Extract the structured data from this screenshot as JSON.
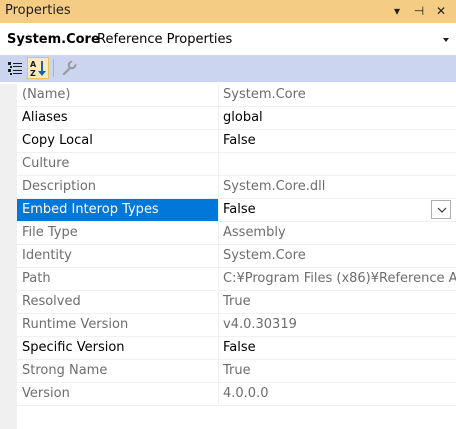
{
  "window": {
    "title": "Properties",
    "pin_glyph": "▾",
    "autohide_glyph": "⊣",
    "close_glyph": "✕"
  },
  "header": {
    "object_name": "System.Core",
    "object_type": "Reference Properties"
  },
  "toolbar": {
    "buttons": [
      {
        "icon": "categorized-icon",
        "active": false
      },
      {
        "icon": "alphabetical-sort-icon",
        "active": true
      },
      {
        "icon": "property-pages-wrench-icon",
        "active": false
      }
    ]
  },
  "properties": [
    {
      "name": "(Name)",
      "value": "System.Core",
      "readonly": true
    },
    {
      "name": "Aliases",
      "value": "global",
      "readonly": false
    },
    {
      "name": "Copy Local",
      "value": "False",
      "readonly": false
    },
    {
      "name": "Culture",
      "value": "",
      "readonly": true
    },
    {
      "name": "Description",
      "value": "System.Core.dll",
      "readonly": true
    },
    {
      "name": "Embed Interop Types",
      "value": "False",
      "readonly": false,
      "selected": true
    },
    {
      "name": "File Type",
      "value": "Assembly",
      "readonly": true
    },
    {
      "name": "Identity",
      "value": "System.Core",
      "readonly": true
    },
    {
      "name": "Path",
      "value": "C:¥Program Files (x86)¥Reference A",
      "readonly": true
    },
    {
      "name": "Resolved",
      "value": "True",
      "readonly": true
    },
    {
      "name": "Runtime Version",
      "value": "v4.0.30319",
      "readonly": true
    },
    {
      "name": "Specific Version",
      "value": "False",
      "readonly": false
    },
    {
      "name": "Strong Name",
      "value": "True",
      "readonly": true
    },
    {
      "name": "Version",
      "value": "4.0.0.0",
      "readonly": true
    }
  ],
  "colors": {
    "title_bar": "#f5cc84",
    "toolbar": "#ccd5f0",
    "selection": "#0078d7",
    "readonly_text": "#6d6d6d"
  }
}
